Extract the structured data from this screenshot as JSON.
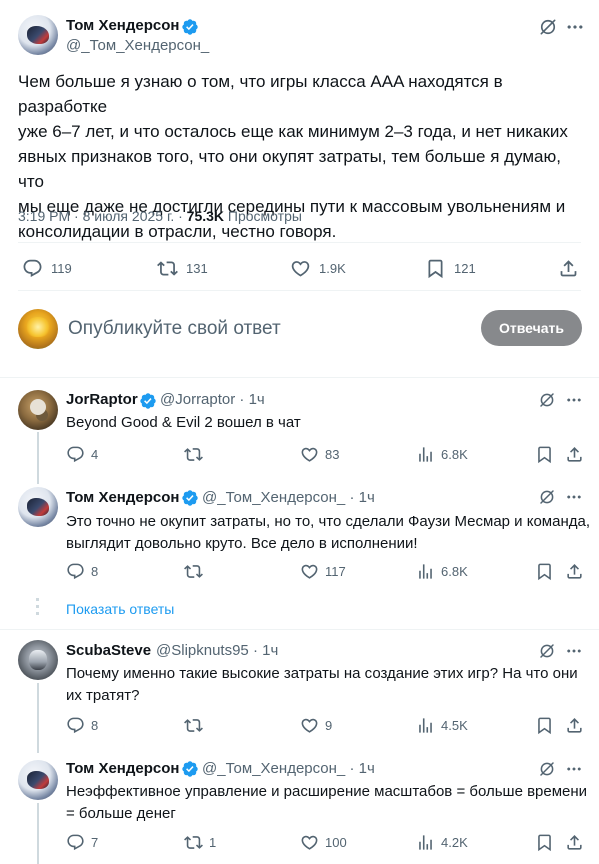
{
  "main_post": {
    "author_name": "Том Хендерсон",
    "author_handle": "@_Том_Хендерсон_",
    "text_lines": [
      "Чем больше я узнаю о том, что игры класса AAA находятся в разработке",
      "уже 6–7 лет, и что осталось еще как минимум 2–3 года, и нет никаких",
      "явных признаков того, что они окупят затраты, тем больше я думаю, что",
      "мы еще даже не достигли середины пути к массовым увольнениям и",
      "консолидации в отрасли, честно говоря."
    ],
    "time": "3:19 PM · 8 июля 2025 г. ·",
    "views_count": "75.3K",
    "views_label": "Просмотры",
    "replies": "119",
    "reposts": "131",
    "likes": "1.9K",
    "bookmarks": "121"
  },
  "compose": {
    "placeholder": "Опубликуйте свой ответ",
    "button": "Отвечать"
  },
  "replies": [
    {
      "name": "JorRaptor",
      "handle": "@Jorraptor",
      "time": "· 1ч",
      "lines": [
        "Beyond Good & Evil 2 вошел в чат"
      ],
      "replies": "4",
      "reposts": "",
      "likes": "83",
      "views": "6.8K"
    },
    {
      "name": "Том Хендерсон",
      "handle": "@_Том_Хендерсон_",
      "time": "· 1ч",
      "lines": [
        "Это точно не окупит затраты, но то, что сделали Фаузи Месмар и команда,",
        "выглядит довольно круто. Все дело в исполнении!"
      ],
      "replies": "8",
      "reposts": "",
      "likes": "117",
      "views": "6.8K"
    },
    {
      "name": "ScubaSteve",
      "handle": "@Slipknuts95",
      "time": "· 1ч",
      "lines": [
        "Почему именно такие высокие затраты на создание этих игр? На что они",
        "их тратят?"
      ],
      "replies": "8",
      "reposts": "",
      "likes": "9",
      "views": "4.5K"
    },
    {
      "name": "Том Хендерсон",
      "handle": "@_Том_Хендерсон_",
      "time": "· 1ч",
      "lines": [
        "Неэффективное управление и расширение масштабов = больше времени",
        "= больше денег"
      ],
      "replies": "7",
      "reposts": "1",
      "likes": "100",
      "views": "4.2K"
    }
  ],
  "show_replies": "Показать ответы",
  "colors": {
    "text": "#0f1419",
    "secondary": "#536471",
    "verified": "#1d9bf0",
    "link": "#1d9bf0",
    "divider": "#eff3f4",
    "reply_button": "#87898c"
  }
}
